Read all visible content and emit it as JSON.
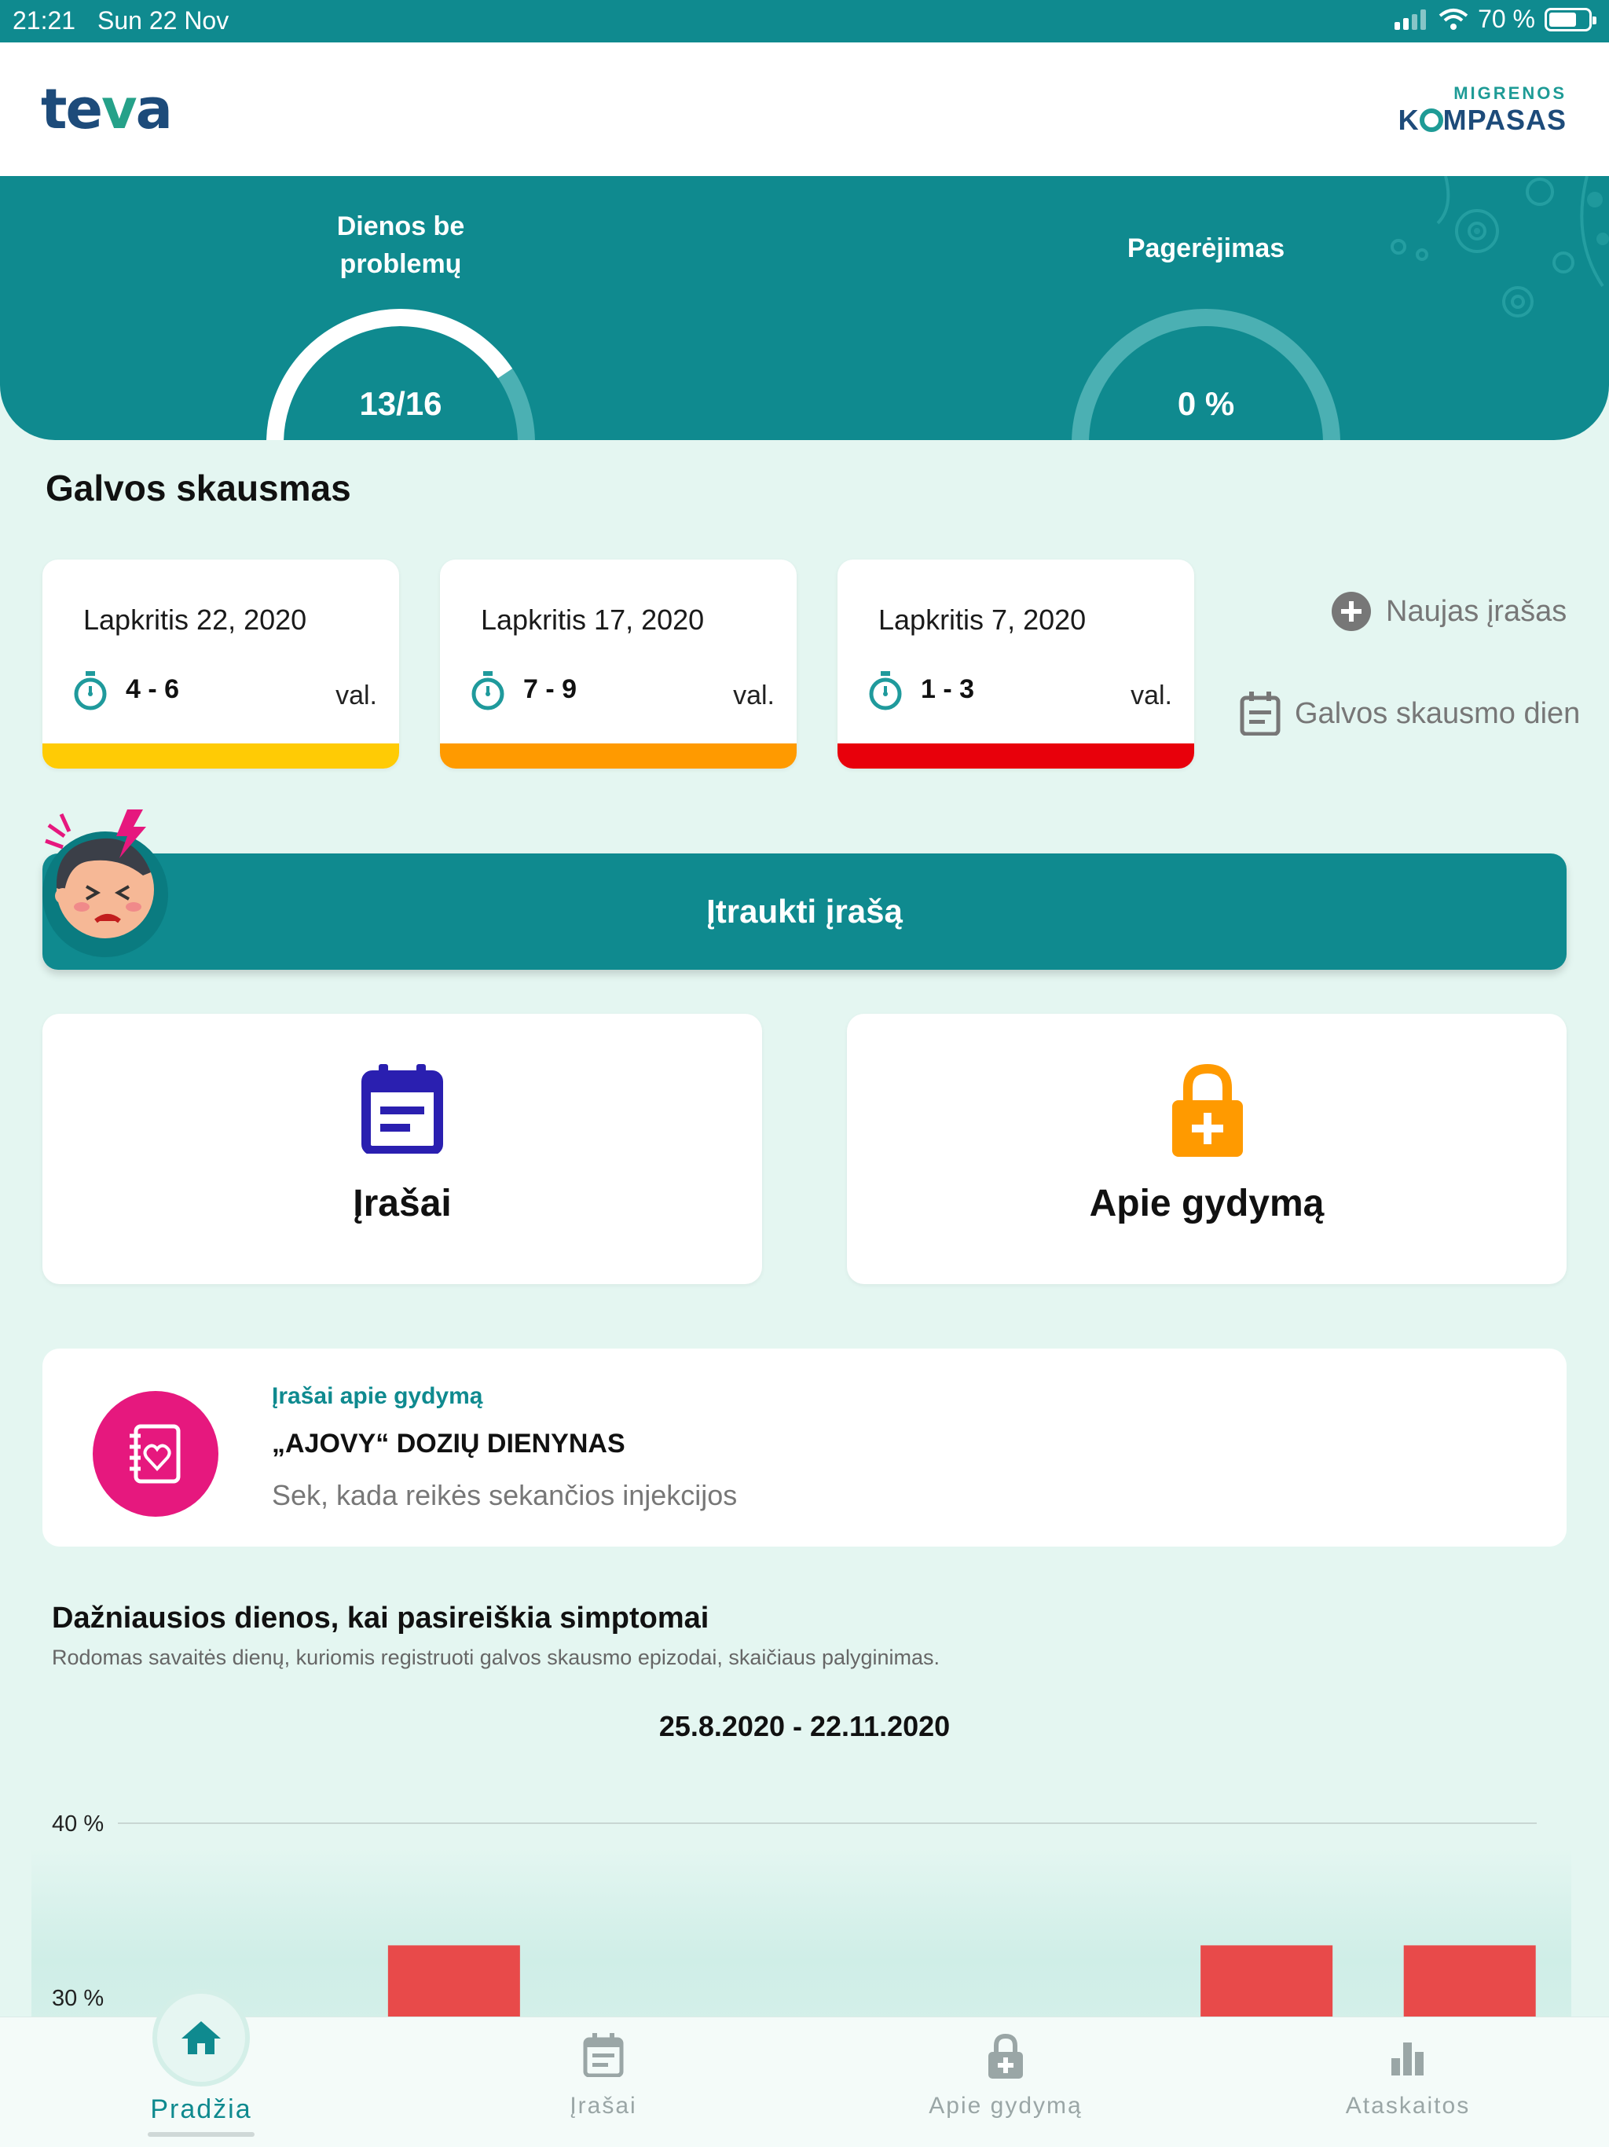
{
  "status_bar": {
    "time": "21:21",
    "date": "Sun 22 Nov",
    "battery": "70 %",
    "battery_level": 0.7
  },
  "header": {
    "logo_left_a": "te",
    "logo_left_b": "v",
    "logo_left_c": "a",
    "logo_right_small": "MIGRENOS",
    "logo_right_big_a": "K",
    "logo_right_big_b": "MPASAS"
  },
  "hero": {
    "gauge1_label_line1": "Dienos be",
    "gauge1_label_line2": "problemų",
    "gauge1_value": "13/16",
    "gauge1_fraction": 0.8125,
    "gauge2_label": "Pagerėjimas",
    "gauge2_value": "0 %",
    "gauge2_fraction": 0
  },
  "headache": {
    "section_title": "Galvos skausmas",
    "cards": [
      {
        "date": "Lapkritis 22, 2020",
        "hours": "4 - 6",
        "unit": "val.",
        "color": "#ffcb05"
      },
      {
        "date": "Lapkritis 17, 2020",
        "hours": "7 - 9",
        "unit": "val.",
        "color": "#ff9a00"
      },
      {
        "date": "Lapkritis 7, 2020",
        "hours": "1 - 3",
        "unit": "val.",
        "color": "#e8000b"
      }
    ],
    "new_entry": "Naujas įrašas",
    "diary": "Galvos skausmo dien"
  },
  "add_entry_button": "Įtraukti įrašą",
  "tiles": {
    "entries": "Įrašai",
    "treatment": "Apie gydymą"
  },
  "info_card": {
    "kicker": "Įrašai apie gydymą",
    "title": "„AJOVY“ DOZIŲ DIENYNAS",
    "subtitle": "Sek, kada reikės sekančios injekcijos"
  },
  "chart_section": {
    "title": "Dažniausios dienos, kai pasireiškia simptomai",
    "subtitle": "Rodomas savaitės dienų, kuriomis registruoti galvos skausmo epizodai, skaičiaus palyginimas.",
    "range": "25.8.2020 - 22.11.2020"
  },
  "chart_data": {
    "type": "bar",
    "title": "Dažniausios dienos, kai pasireiškia simptomai",
    "ytick_labels": [
      "40 %",
      "30 %"
    ],
    "yticks": [
      40,
      30
    ],
    "ylim": [
      0,
      40
    ],
    "grid": true,
    "bar_color": "#e84a4a",
    "values": [
      null,
      33,
      null,
      null,
      null,
      33,
      33
    ],
    "note_visible_cropped": true
  },
  "tabbar": {
    "tabs": [
      {
        "label": "Pradžia",
        "icon": "home-icon",
        "active": true
      },
      {
        "label": "Įrašai",
        "icon": "notes-icon",
        "active": false
      },
      {
        "label": "Apie gydymą",
        "icon": "lock-plus-icon",
        "active": false
      },
      {
        "label": "Ataskaitos",
        "icon": "bar-chart-icon",
        "active": false
      }
    ]
  },
  "colors": {
    "teal": "#0f8a8f",
    "page_bg": "#e4f6f1",
    "accent_pink": "#e6187e",
    "accent_orange": "#ff9a00",
    "accent_indigo": "#2a1fb0"
  }
}
